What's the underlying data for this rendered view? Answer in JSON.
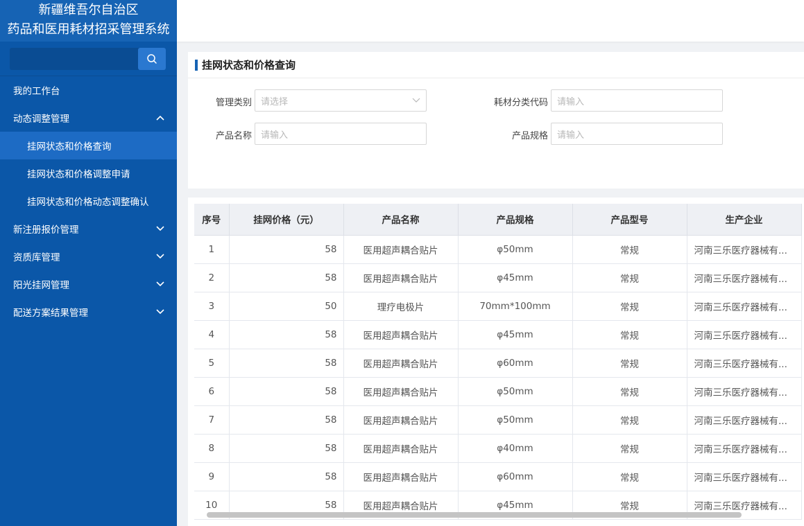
{
  "app": {
    "title_line1": "新疆维吾尔自治区",
    "title_line2": "药品和医用耗材招采管理系统"
  },
  "search": {
    "placeholder": "",
    "icon": "search-icon"
  },
  "menu": [
    {
      "label": "我的工作台",
      "level": 1,
      "icon": "",
      "active": false
    },
    {
      "label": "动态调整管理",
      "level": 1,
      "icon": "chevron-up-icon",
      "active": false
    },
    {
      "label": "挂网状态和价格查询",
      "level": 2,
      "icon": "",
      "active": true
    },
    {
      "label": "挂网状态和价格调整申请",
      "level": 2,
      "icon": "",
      "active": false
    },
    {
      "label": "挂网状态和价格动态调整确认",
      "level": 2,
      "icon": "",
      "active": false
    },
    {
      "label": "新注册报价管理",
      "level": 1,
      "icon": "chevron-down-icon",
      "active": false
    },
    {
      "label": "资质库管理",
      "level": 1,
      "icon": "chevron-down-icon",
      "active": false
    },
    {
      "label": "阳光挂网管理",
      "level": 1,
      "icon": "chevron-down-icon",
      "active": false
    },
    {
      "label": "配送方案结果管理",
      "level": 1,
      "icon": "chevron-down-icon",
      "active": false
    }
  ],
  "query": {
    "title": "挂网状态和价格查询",
    "fields": {
      "category": {
        "label": "管理类别",
        "placeholder": "请选择"
      },
      "code": {
        "label": "耗材分类代码",
        "placeholder": "请输入"
      },
      "name": {
        "label": "产品名称",
        "placeholder": "请输入"
      },
      "spec": {
        "label": "产品规格",
        "placeholder": "请输入"
      }
    }
  },
  "table": {
    "columns": [
      "序号",
      "挂网价格（元）",
      "产品名称",
      "产品规格",
      "产品型号",
      "生产企业"
    ],
    "rows": [
      [
        "1",
        "58",
        "医用超声耦合贴片",
        "φ50mm",
        "常规",
        "河南三乐医疗器械有..."
      ],
      [
        "2",
        "58",
        "医用超声耦合贴片",
        "φ45mm",
        "常规",
        "河南三乐医疗器械有..."
      ],
      [
        "3",
        "50",
        "理疗电极片",
        "70mm*100mm",
        "常规",
        "河南三乐医疗器械有..."
      ],
      [
        "4",
        "58",
        "医用超声耦合贴片",
        "φ45mm",
        "常规",
        "河南三乐医疗器械有..."
      ],
      [
        "5",
        "58",
        "医用超声耦合贴片",
        "φ60mm",
        "常规",
        "河南三乐医疗器械有..."
      ],
      [
        "6",
        "58",
        "医用超声耦合贴片",
        "φ50mm",
        "常规",
        "河南三乐医疗器械有..."
      ],
      [
        "7",
        "58",
        "医用超声耦合贴片",
        "φ50mm",
        "常规",
        "河南三乐医疗器械有..."
      ],
      [
        "8",
        "58",
        "医用超声耦合贴片",
        "φ40mm",
        "常规",
        "河南三乐医疗器械有..."
      ],
      [
        "9",
        "58",
        "医用超声耦合贴片",
        "φ60mm",
        "常规",
        "河南三乐医疗器械有..."
      ],
      [
        "10",
        "58",
        "医用超声耦合贴片",
        "φ45mm",
        "常规",
        "河南三乐医疗器械有..."
      ]
    ]
  },
  "colors": {
    "sidebar_bg": "#0b57a8",
    "sidebar_header_bg": "#1663b4",
    "active_item_bg": "#1d6bc4",
    "accent": "#1663b4"
  }
}
